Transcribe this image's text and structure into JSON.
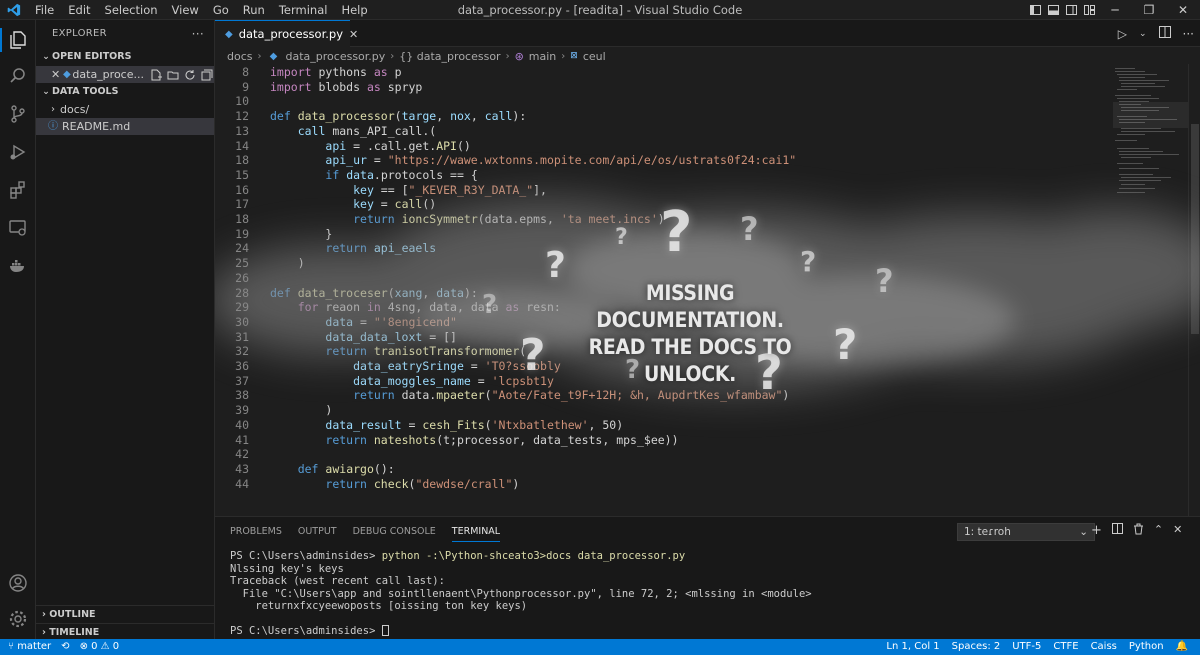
{
  "menu": [
    "File",
    "Edit",
    "Selection",
    "View",
    "Go",
    "Run",
    "Terminal",
    "Help"
  ],
  "window_title": "data_processor.py - [readita] - Visual Studio Code",
  "sidebar": {
    "title": "EXPLORER",
    "more": "···",
    "open_editors_label": "OPEN EDITORS",
    "open_file": "data_proce...",
    "project_label": "DATA TOOLS",
    "folder": "docs/",
    "readme": "README.md",
    "outline_label": "OUTLINE",
    "timeline_label": "TIMELINE"
  },
  "tab": {
    "label": "data_processor.py"
  },
  "breadcrumb": [
    "docs",
    "data_processor.py",
    "{} data_processor",
    "main",
    "ceul"
  ],
  "code_lines": [
    {
      "n": "8",
      "html": "<span class='imp'>import</span> pythons <span class='imp'>as</span> p"
    },
    {
      "n": "9",
      "html": "<span class='imp'>import</span> blobds <span class='imp'>as</span> spryp"
    },
    {
      "n": "10",
      "html": ""
    },
    {
      "n": "12",
      "html": "<span class='kw'>def</span> <span class='fn'>data_processor</span>(<span class='var'>targe</span>, <span class='var'>nox</span>, <span class='var'>call</span>):"
    },
    {
      "n": "13",
      "html": "    <span class='var'>call</span> mans_API_call.("
    },
    {
      "n": "14",
      "html": "        <span class='var'>api</span> = .call.get.<span class='fn'>API</span>()"
    },
    {
      "n": "18",
      "html": "        <span class='var'>api_ur</span> = <span class='str'>\"https://wawe.wxtonns.mopite.com/api/e/os/ustrats0f24:cai1\"</span>"
    },
    {
      "n": "15",
      "html": "        <span class='kw'>if</span> <span class='var'>data</span>.protocols == {"
    },
    {
      "n": "16",
      "html": "            <span class='var'>key</span> == [<span class='str'>\"_KEVER_R3Y_DATA_\"</span>],"
    },
    {
      "n": "17",
      "html": "            <span class='var'>key</span> = <span class='fn'>call</span>()"
    },
    {
      "n": "18",
      "html": "            <span class='kw'>return</span> <span class='fn'>ioncSymmetr</span>(data.epms, <span class='str'>'ta meet.incs'</span>)"
    },
    {
      "n": "19",
      "html": "        }"
    },
    {
      "n": "24",
      "html": "        <span class='kw'>return</span> <span class='var'>api_eaels</span>"
    },
    {
      "n": "25",
      "html": "    )"
    },
    {
      "n": "26",
      "html": ""
    },
    {
      "n": "28",
      "html": "<span class='kw'>def</span> <span class='fn'>data_troceser</span>(<span class='var'>xang</span>, <span class='var'>data</span>):"
    },
    {
      "n": "29",
      "html": "    <span class='imp'>for</span> reaon <span class='imp'>in</span> 4sng, data, data <span class='imp'>as</span> resn:"
    },
    {
      "n": "30",
      "html": "        <span class='var'>data</span> = <span class='str'>\"'8engicend\"</span>"
    },
    {
      "n": "31",
      "html": "        <span class='var'>data_data_loxt</span> = []"
    },
    {
      "n": "32",
      "html": "        <span class='kw'>return</span> <span class='fn'>tranisotTransformomer</span>("
    },
    {
      "n": "36",
      "html": "            <span class='var'>data_eatrySringe</span> = <span class='str'>'T0?ssoobly</span>"
    },
    {
      "n": "37",
      "html": "            <span class='var'>data_moggles_name</span> = <span class='str'>'lcpsbt1y</span>"
    },
    {
      "n": "38",
      "html": "            <span class='kw'>return</span> data.<span class='fn'>mpaeter</span>(<span class='str'>\"Aote/Fate_t9F+12H; &h, AupdrtKes_wfambaw\"</span>)"
    },
    {
      "n": "39",
      "html": "        )"
    },
    {
      "n": "40",
      "html": "        <span class='var'>data_result</span> = <span class='fn'>cesh_Fits</span>(<span class='str'>'Ntxbatlethew'</span>, 50)"
    },
    {
      "n": "41",
      "html": "        <span class='kw'>return</span> <span class='fn'>nateshots</span>(t;processor, data_tests, mps_$ee))"
    },
    {
      "n": "42",
      "html": ""
    },
    {
      "n": "43",
      "html": "    <span class='kw'>def</span> <span class='fn'>awiargo</span>():"
    },
    {
      "n": "44",
      "html": "        <span class='kw'>return</span> <span class='fn'>check</span>(<span class='str'>\"dewdse/crall\"</span>)"
    }
  ],
  "overlay_text": [
    "MISSING DOCUMENTATION.",
    "READ THE DOCS TO UNLOCK."
  ],
  "panel": {
    "tabs": [
      "PROBLEMS",
      "OUTPUT",
      "DEBUG CONSOLE",
      "TERMINAL"
    ],
    "active_tab": "TERMINAL",
    "terminal_select": "1: teɾroh",
    "terminal_lines": [
      "PS C:\\Users\\adminsides> python -:\\Python-shceato3>docs data_processor.py",
      "Nlssing key's keys",
      "Traceback (west recent call last):",
      "  File \"C:\\Users\\app and sointllenaent\\Pythonprocessor.py\", line 72, 2; <mlssing in <module>",
      "    returnxfxcyeewoposts [oissing ton key keys)",
      "",
      "PS C:\\Users\\adminsides> "
    ]
  },
  "status": {
    "branch": "matter",
    "sync": "⟲",
    "problems": "⊗ 0 ⚠ 0",
    "right": [
      "Ln 1, Col 1",
      "Spaces: 2",
      "UTF-5",
      "CTFE",
      "Caiss",
      "Python",
      "🔔"
    ]
  },
  "colors": {
    "accent": "#0078d4",
    "statusbar": "#0078d4",
    "editor_bg": "#1e1e1e",
    "sidebar_bg": "#181818"
  }
}
